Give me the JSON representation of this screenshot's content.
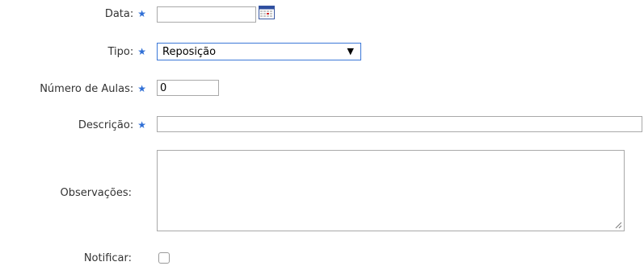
{
  "form": {
    "data": {
      "label": "Data:",
      "value": ""
    },
    "tipo": {
      "label": "Tipo:",
      "selected": "Reposição"
    },
    "numero_aulas": {
      "label": "Número de Aulas:",
      "value": "0"
    },
    "descricao": {
      "label": "Descrição:",
      "value": ""
    },
    "observacoes": {
      "label": "Observações:",
      "value": ""
    },
    "notificar": {
      "label": "Notificar:",
      "checked": false
    }
  },
  "required_marker": "★",
  "colors": {
    "required_star": "#2f6fd6",
    "select_focus_border": "#3c78d8",
    "field_border": "#a9a9a9"
  },
  "icons": {
    "calendar": "calendar-icon",
    "dropdown": "dropdown-arrow-icon",
    "resize": "resize-grip-icon"
  }
}
